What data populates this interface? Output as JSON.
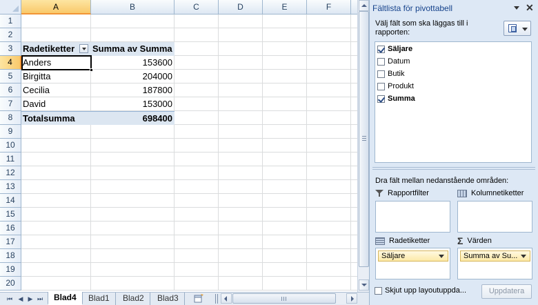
{
  "sheet": {
    "columns": [
      "A",
      "B",
      "C",
      "D",
      "E",
      "F"
    ],
    "active_column": "A",
    "rows": [
      "1",
      "2",
      "3",
      "4",
      "5",
      "6",
      "7",
      "8",
      "9",
      "10",
      "11",
      "12",
      "13",
      "14",
      "15",
      "16",
      "17",
      "18",
      "19",
      "20"
    ],
    "active_row": "4",
    "pivot": {
      "header_row_label": "Radetiketter",
      "header_value_label": "Summa av Summa",
      "rows": [
        {
          "label": "Anders",
          "value": "153600"
        },
        {
          "label": "Birgitta",
          "value": "204000"
        },
        {
          "label": "Cecilia",
          "value": "187800"
        },
        {
          "label": "David",
          "value": "153000"
        }
      ],
      "total_label": "Totalsumma",
      "total_value": "698400"
    }
  },
  "tabs": {
    "sheets": [
      "Blad4",
      "Blad1",
      "Blad2",
      "Blad3"
    ],
    "active": "Blad4"
  },
  "pivot_panel": {
    "title": "Fältlista för pivottabell",
    "close_glyph": "✕",
    "instruction": "Välj fält som ska läggas till i rapporten:",
    "fields": [
      {
        "label": "Säljare",
        "checked": true
      },
      {
        "label": "Datum",
        "checked": false
      },
      {
        "label": "Butik",
        "checked": false
      },
      {
        "label": "Produkt",
        "checked": false
      },
      {
        "label": "Summa",
        "checked": true
      }
    ],
    "areas_title": "Dra fält mellan nedanstående områden:",
    "areas": {
      "report_filter": {
        "label": "Rapportfilter",
        "icon": "filter-icon"
      },
      "column_labels": {
        "label": "Kolumnetiketter",
        "icon": "column-grid-icon"
      },
      "row_labels": {
        "label": "Radetiketter",
        "icon": "row-grid-icon",
        "item": "Säljare"
      },
      "values": {
        "label": "Värden",
        "icon": "sigma-icon",
        "item": "Summa av Su..."
      }
    },
    "defer_label": "Skjut upp layoutuppda...",
    "update_label": "Uppdatera"
  },
  "colors": {
    "header_fill": "#dce6f1",
    "active_header": "#f9c96b",
    "panel_bg": "#dde8f5"
  }
}
